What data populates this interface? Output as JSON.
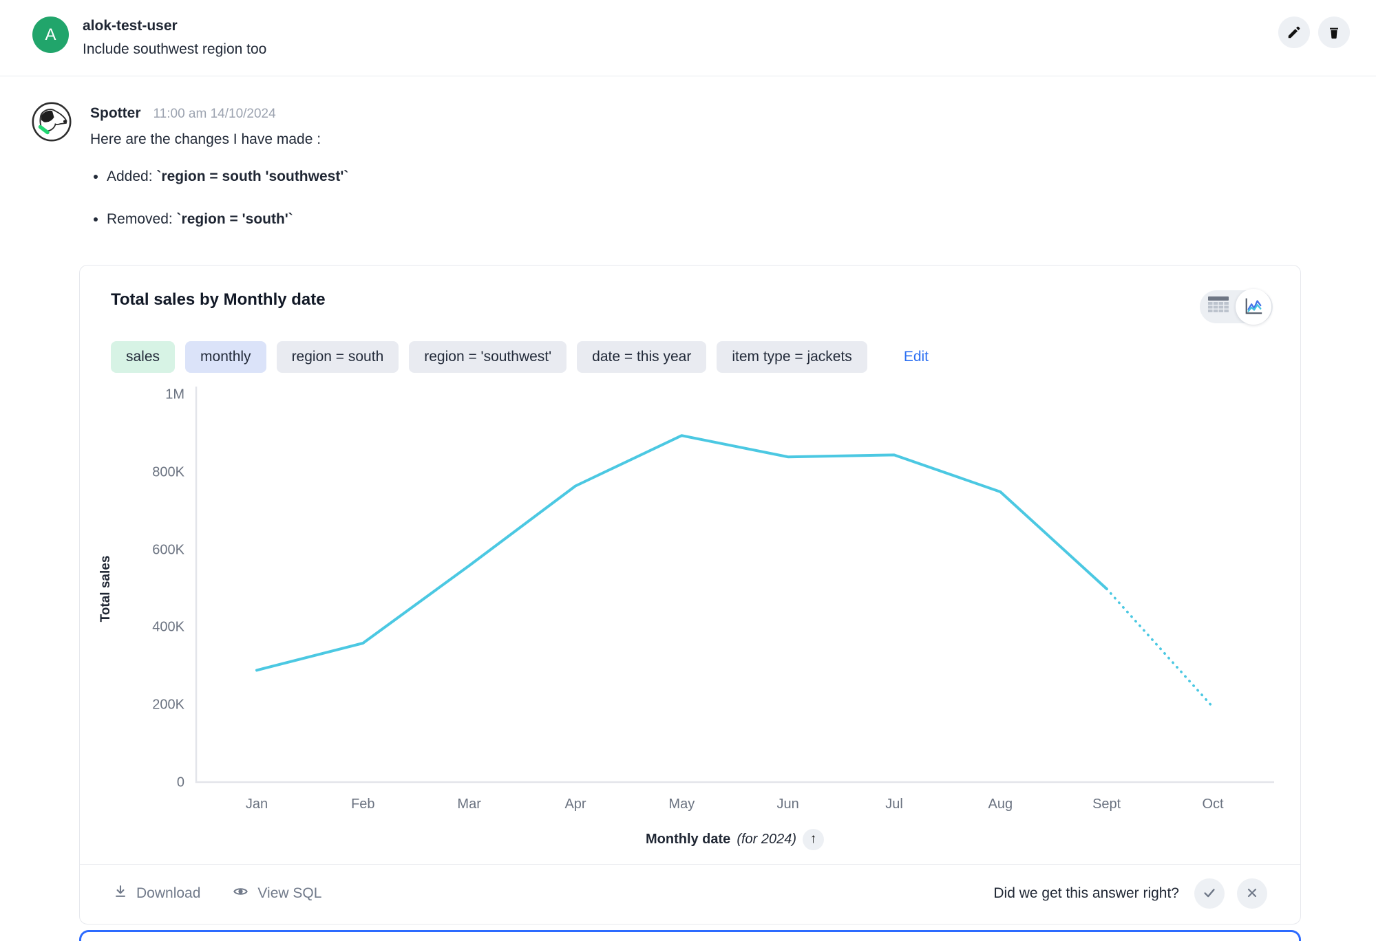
{
  "user_message": {
    "avatar_initial": "A",
    "username": "alok-test-user",
    "text": "Include southwest region too"
  },
  "assistant": {
    "name": "Spotter",
    "timestamp": "11:00 am 14/10/2024",
    "intro": "Here are the changes I have made :",
    "changes": [
      {
        "label": "Added: ",
        "code": "`region = south 'southwest'`"
      },
      {
        "label": "Removed: ",
        "code": "`region = 'south'`"
      }
    ]
  },
  "card": {
    "title": "Total sales by Monthly date",
    "view_toggle": {
      "options": [
        "table",
        "chart"
      ],
      "selected": "chart"
    },
    "tokens": [
      {
        "label": "sales",
        "type": "measure"
      },
      {
        "label": "monthly",
        "type": "time"
      },
      {
        "label": "region = south",
        "type": "filter"
      },
      {
        "label": "region = 'southwest'",
        "type": "filter"
      },
      {
        "label": "date = this year",
        "type": "filter"
      },
      {
        "label": "item type = jackets",
        "type": "filter"
      }
    ],
    "edit_label": "Edit",
    "sort_arrow_glyph": "↑",
    "footer": {
      "download_label": "Download",
      "view_sql_label": "View SQL",
      "feedback_question": "Did we get this answer right?"
    }
  },
  "chart_data": {
    "type": "line",
    "title": "Total sales by Monthly date",
    "x": [
      "Jan",
      "Feb",
      "Mar",
      "Apr",
      "May",
      "Jun",
      "Jul",
      "Aug",
      "Sept",
      "Oct"
    ],
    "series": [
      {
        "name": "Total sales",
        "values": [
          290000,
          360000,
          560000,
          765000,
          895000,
          840000,
          845000,
          750000,
          500000,
          195000
        ]
      }
    ],
    "dashed_from_index": 8,
    "dashed_note": "Sept to Oct segment is dotted (projection)",
    "ylabel": "Total sales",
    "xlabel": "Monthly date",
    "xlabel_suffix": "(for 2024)",
    "ylim": [
      0,
      1000000
    ],
    "ytick_labels_top_to_bottom": [
      "1M",
      "800K",
      "600K",
      "400K",
      "200K",
      "0"
    ],
    "grid": false,
    "legend": "none",
    "line_color": "#4bc8e2"
  },
  "colors": {
    "avatar_green": "#21a56b",
    "line_cyan": "#4bc8e2",
    "edit_blue": "#2b6ff2",
    "chip_measure_bg": "#d7f3e5",
    "chip_time_bg": "#dbe3f9",
    "chip_filter_bg": "#e9ebf1",
    "bottom_bar_blue": "#2d6bff",
    "collar_green": "#21d671"
  }
}
